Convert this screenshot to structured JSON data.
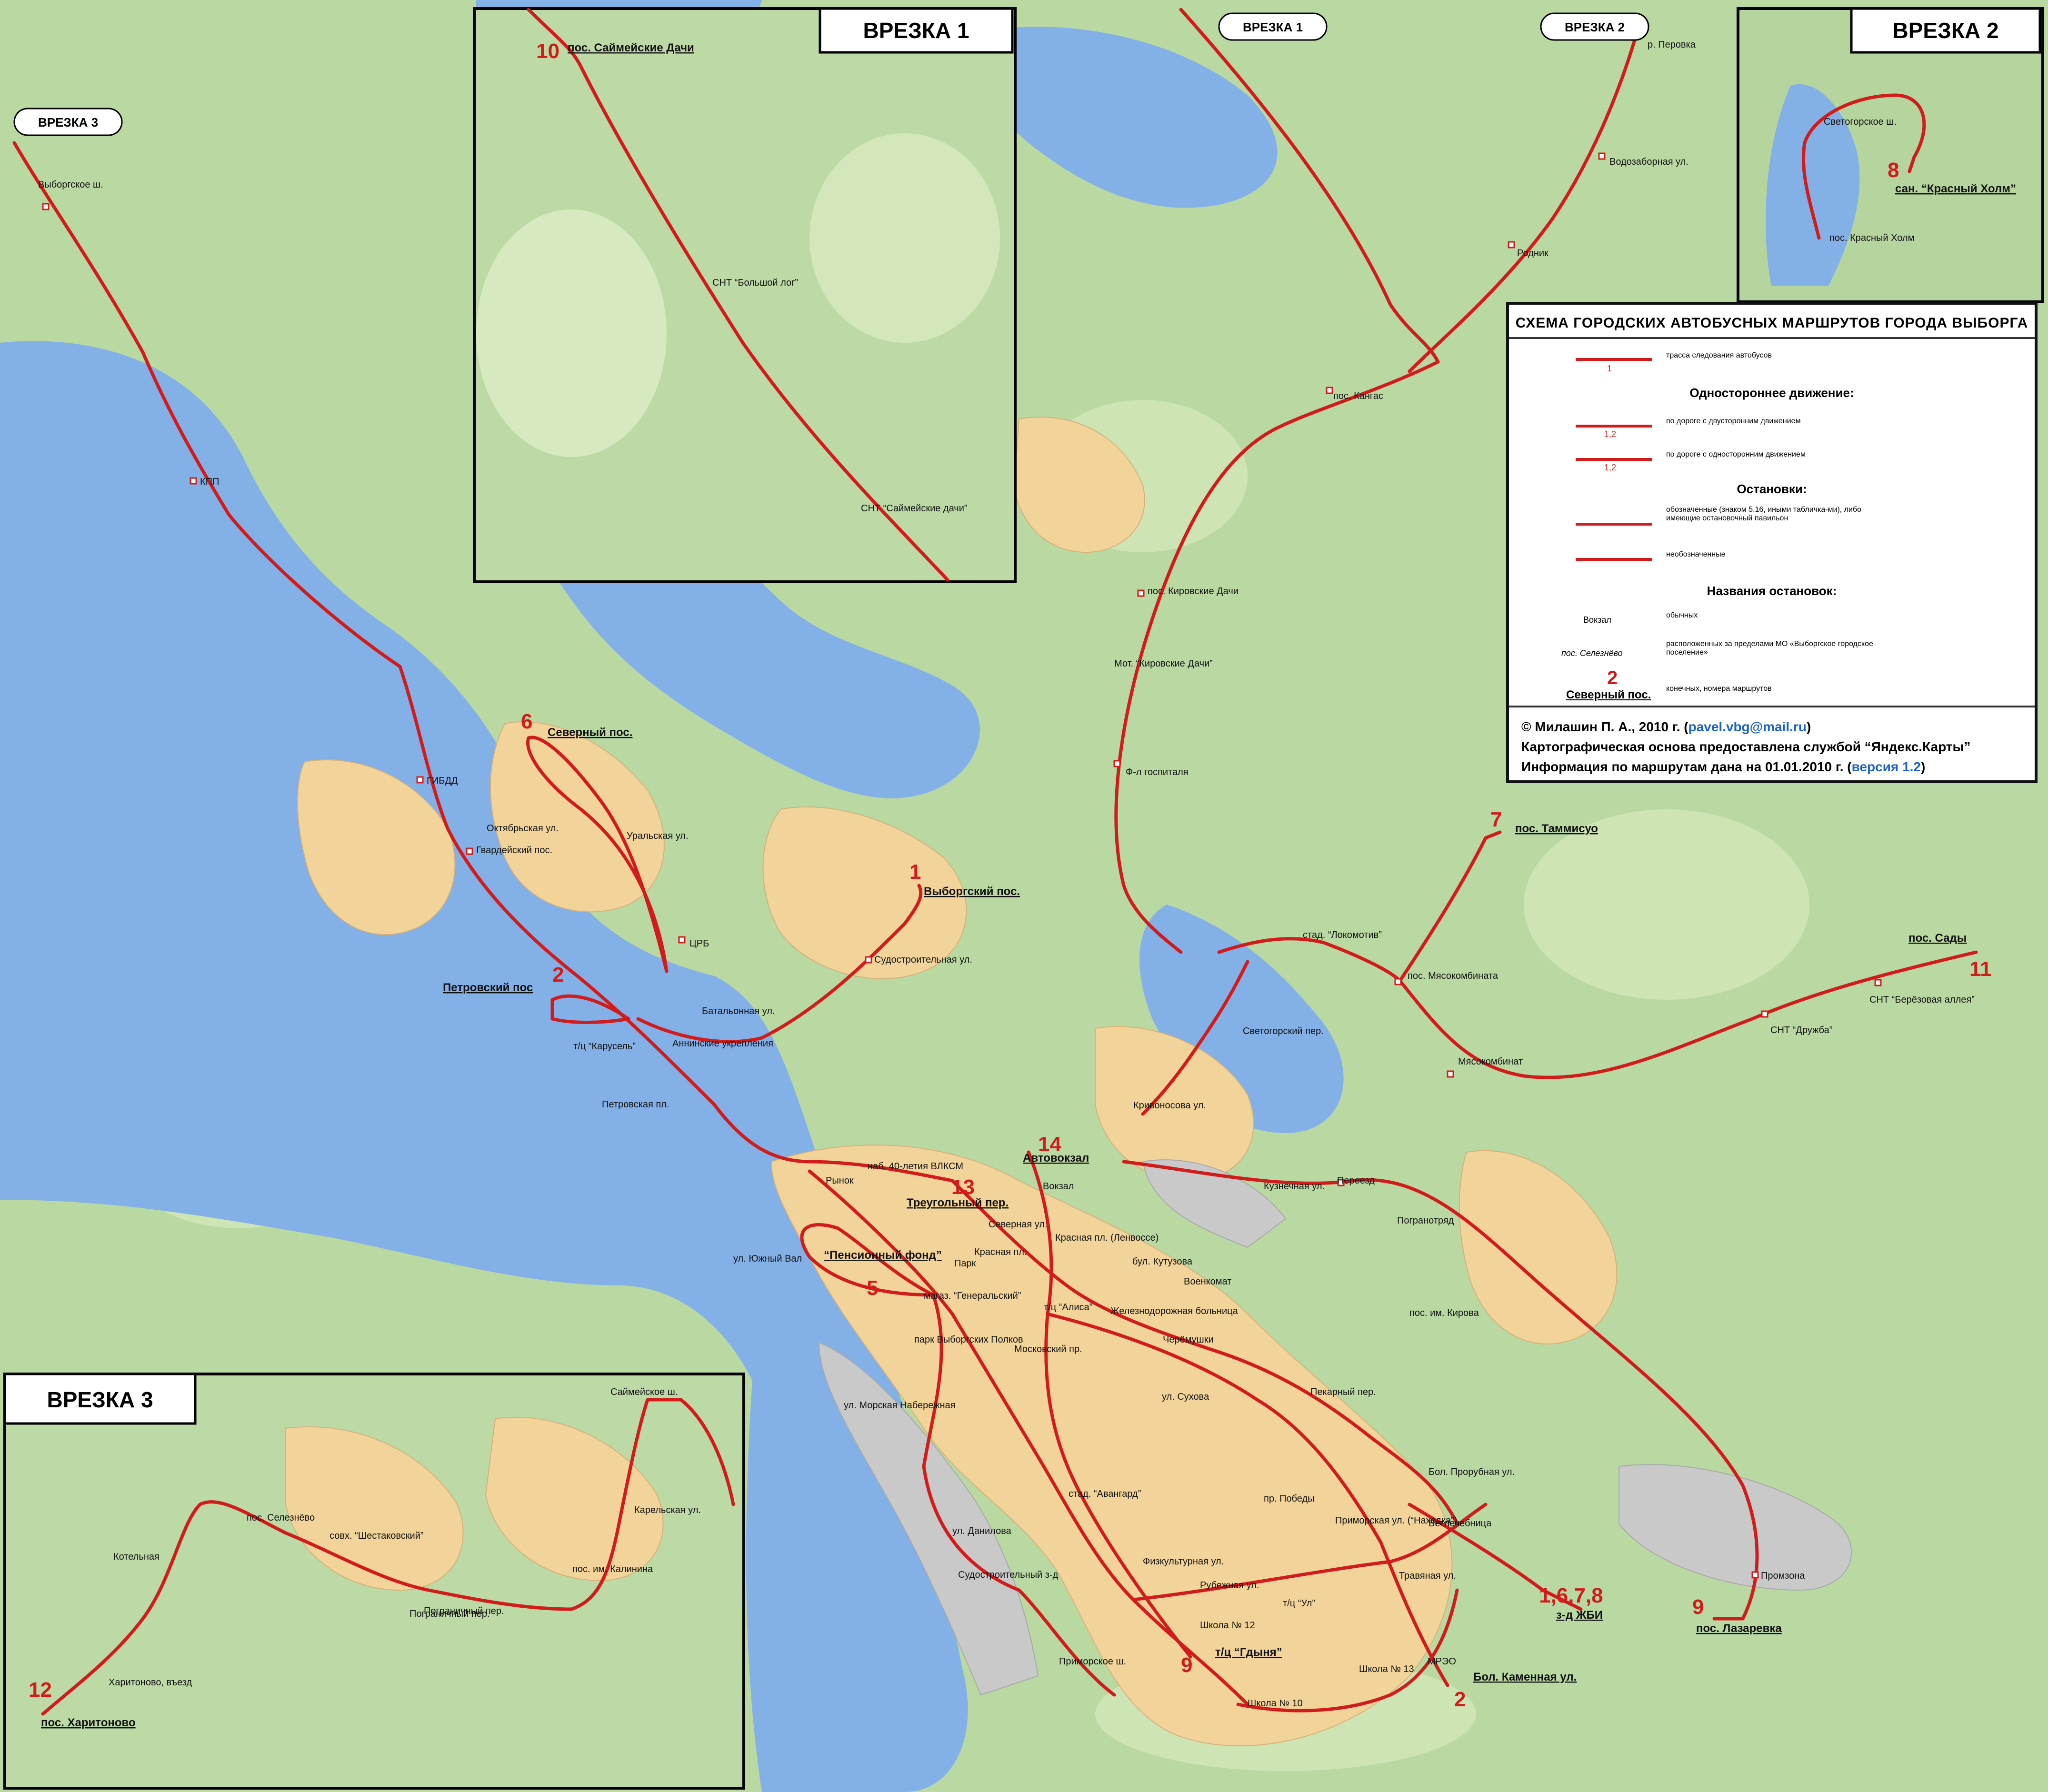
{
  "legend": {
    "title": "СХЕМА ГОРОДСКИХ АВТОБУСНЫХ МАРШРУТОВ ГОРОДА ВЫБОРГА",
    "route_item": "трасса следования автобусов",
    "route_sample_num": "1",
    "oneway_header": "Одностороннее движение:",
    "oneway_two": "по дороге с двусторонним движением",
    "oneway_one": "по дороге с односторонним движением",
    "oneway_sample": "1,2",
    "stops_header": "Остановки:",
    "stops_marked": "обозначенные (знаком 5.16, иными табличка-ми), либо имеющие остановочный павильон",
    "stops_unmarked": "необозначенные",
    "names_header": "Названия остановок:",
    "names_regular_sample": "Вокзал",
    "names_regular": "обычных",
    "names_outside_sample": "пос. Селезнёво",
    "names_outside": "расположенных за пределами МО «Выборгское городское поселение»",
    "terminal_num": "2",
    "terminal_name": "Северный пос.",
    "terminal_desc": "конечных, номера маршрутов",
    "credit_line1_pre": "© Милашин П. А., 2010 г. (",
    "credit_email": "pavel.vbg@mail.ru",
    "credit_line1_post": ")",
    "credit_line2": "Картографическая основа предоставлена службой “Яндекс.Карты”",
    "credit_line3_pre": "Информация по маршрутам дана на 01.01.2010 г. (",
    "credit_version": "версия 1.2",
    "credit_line3_post": ")"
  },
  "insets": {
    "inset1": "ВРЕЗКА 1",
    "inset2": "ВРЕЗКА 2",
    "inset3": "ВРЕЗКА 3"
  },
  "pointers": {
    "p_inset3": "ВРЕЗКА 3",
    "p_inset1": "ВРЕЗКА 1",
    "p_inset2": "ВРЕЗКА 2"
  },
  "terminals": [
    {
      "num": "10",
      "name": "пос. Саймейские Дачи"
    },
    {
      "num": "8",
      "name": "сан. “Красный Холм”"
    },
    {
      "num": "6",
      "name": "Северный пос."
    },
    {
      "num": "1",
      "name": "Выборгский пос."
    },
    {
      "num": "2",
      "name": "Петровский пос"
    },
    {
      "num": "7",
      "name": "пос. Таммисуо"
    },
    {
      "num": "11",
      "name": "пос. Сады"
    },
    {
      "num": "14",
      "name": "Автовокзал"
    },
    {
      "num": "13",
      "name": "Треугольный пер."
    },
    {
      "num": "5",
      "name": "“Пенсионный фонд”"
    },
    {
      "num": "1,6,7,8",
      "name": "з-д ЖБИ"
    },
    {
      "num": "9",
      "name": "пос. Лазаревка"
    },
    {
      "num": "2",
      "name": "Бол. Каменная ул."
    },
    {
      "num": "9",
      "name": "т/ц “Гдыня”"
    },
    {
      "num": "12",
      "name": "пос. Харитоново"
    }
  ],
  "stops": [
    "СНТ “Большой лог”",
    "СНТ “Саймейские дачи”",
    "Светогорское ш.",
    "пос. Красный Холм",
    "р. Перовка",
    "Водозаборная ул.",
    "Родник",
    "пос. Кангас",
    "пос. Кировские Дачи",
    "Мот. “Кировские Дачи”",
    "Ф-л госпиталя",
    "Выборгское ш.",
    "КПП",
    "ГИБДД",
    "Октябрьская ул.",
    "Гвардейский пос.",
    "Уральская ул.",
    "ЦРБ",
    "Судостроительная ул.",
    "Батальонная ул.",
    "Аннинские укрепления",
    "т/ц “Карусель”",
    "Петровская пл.",
    "наб. 40-летия ВЛКСМ",
    "Рынок",
    "ул. Южный Вал",
    "Вокзал",
    "Северная ул.",
    "Красная пл.",
    "Красная пл. (Ленвоссе)",
    "Парк",
    "бул. Кутузова",
    "Военкомат",
    "т/ц “Алиса”",
    "Железнодорожная больница",
    "магаз. “Генеральский”",
    "парк Выборгских Полков",
    "Московский пр.",
    "Черёмушки",
    "ул. Морская Набережная",
    "ул. Сухова",
    "Пекарный пер.",
    "Бол. Прорубная ул.",
    "стад. “Авангард”",
    "пр. Победы",
    "Ветлечебница",
    "Приморская ул. (“Находка”)",
    "ул. Данилова",
    "Физкультурная ул.",
    "Рубежная ул.",
    "Травяная ул.",
    "Судостроительный з-д",
    "т/ц “Ул”",
    "Школа № 12",
    "Приморское ш.",
    "Школа № 13",
    "МРЭО",
    "Школа № 10",
    "Промзона",
    "Пограничный пер.",
    "Кузнечная ул.",
    "Переезд",
    "Погранотряд",
    "пос. им. Кирова",
    "стад. “Локомотив”",
    "пос. Мясокомбината",
    "Мясокомбинат",
    "Светогорский пер.",
    "Кривоносова ул.",
    "СНТ “Дружба”",
    "СНТ “Берёзовая аллея”",
    "Саймейское ш.",
    "пос. Селезнёво",
    "совх. “Шестаковский”",
    "Карельская ул.",
    "пос. им. Калинина",
    "Котельная",
    "Пограничный пер.",
    "Харитоново, въезд"
  ],
  "colors": {
    "route": "#d21c1c",
    "water": "#84b0e8",
    "forest": "#a9d38e",
    "urban": "#f2d49a",
    "industrial": "#cccccc"
  }
}
